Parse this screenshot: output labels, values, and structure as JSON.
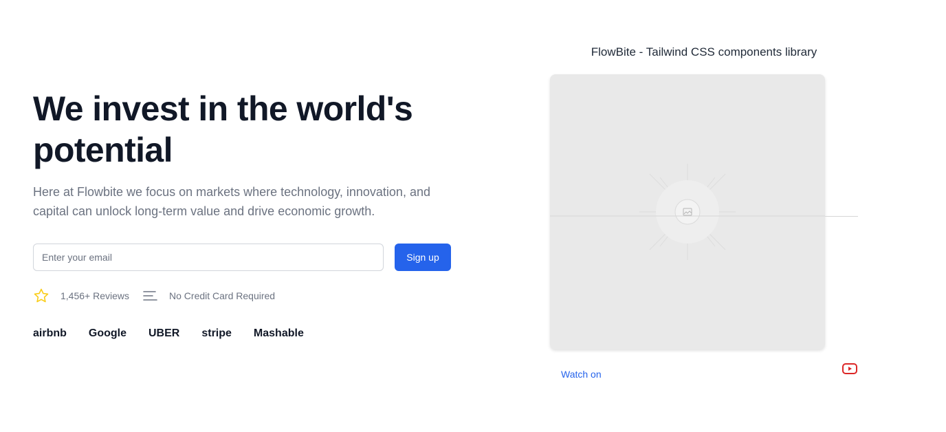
{
  "hero": {
    "title": "We invest in the world's potential",
    "description": "Here at Flowbite we focus on markets where technology, innovation, and capital can unlock long-term value and drive economic growth."
  },
  "form": {
    "email_placeholder": "Enter your email",
    "email_value": "",
    "signup_label": "Sign up"
  },
  "meta": {
    "reviews_text": "1,456+ Reviews",
    "credit_text": "No Credit Card Required",
    "icons": [
      "star-icon",
      "list-icon"
    ]
  },
  "logos": [
    "airbnb",
    "Google",
    "UBER",
    "stripe",
    "Mashable"
  ],
  "video": {
    "title": "FlowBite - Tailwind CSS components library",
    "watch_on": "Watch on",
    "platform_icon": "youtube-icon"
  },
  "colors": {
    "primary": "#2563eb",
    "heading": "#111827",
    "muted": "#6b7280",
    "star": "#facc15",
    "youtube": "#dc2626",
    "video_bg": "#e9e9e9"
  }
}
